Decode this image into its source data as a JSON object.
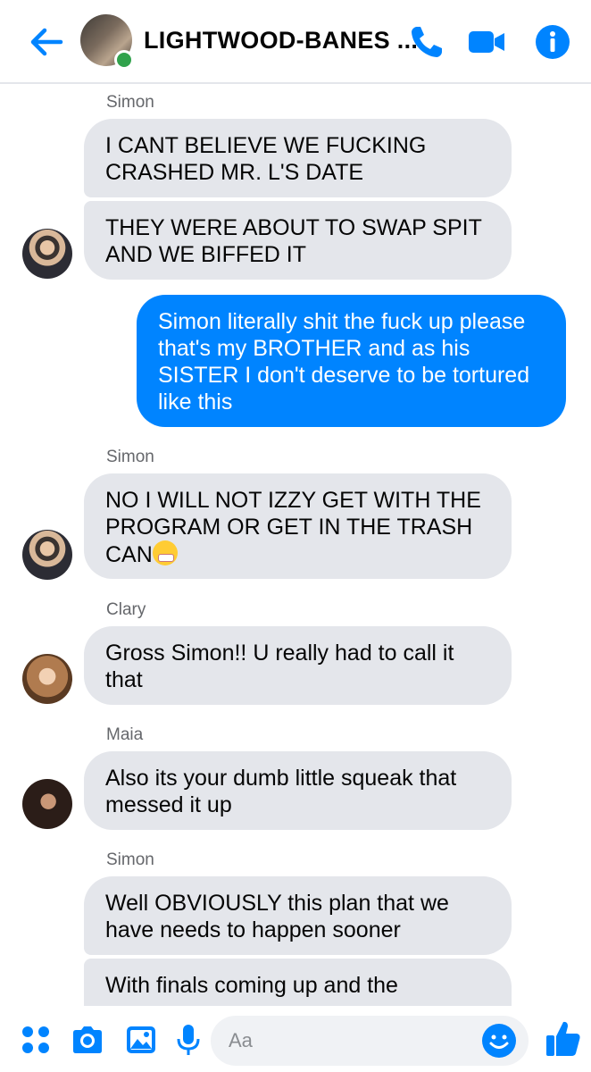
{
  "header": {
    "title": "LIGHTWOOD-BANES ...",
    "back_icon": "back-arrow-icon",
    "call_icon": "phone-icon",
    "video_icon": "video-camera-icon",
    "info_icon": "info-icon",
    "online": true
  },
  "messages": [
    {
      "type": "sender",
      "text": "Simon"
    },
    {
      "type": "received",
      "text": "I CANT BELIEVE WE FUCKING CRASHED MR. L'S DATE"
    },
    {
      "type": "received",
      "text": "THEY WERE ABOUT TO SWAP SPIT AND WE BIFFED IT"
    },
    {
      "type": "sent",
      "text": "Simon literally shit the fuck up please that's my BROTHER and as his SISTER I don't deserve to be tortured like this"
    },
    {
      "type": "sender",
      "text": "Simon"
    },
    {
      "type": "received",
      "text": "NO I WILL NOT IZZY GET WITH THE PROGRAM OR GET IN THE TRASH CAN"
    },
    {
      "type": "sender",
      "text": "Clary"
    },
    {
      "type": "received",
      "text": "Gross Simon!! U really had to call it that"
    },
    {
      "type": "sender",
      "text": "Maia"
    },
    {
      "type": "received",
      "text": "Also its your dumb little squeak that messed it up"
    },
    {
      "type": "sender",
      "text": "Simon"
    },
    {
      "type": "received",
      "text": "Well OBVIOUSLY this plan that we have needs to happen sooner"
    },
    {
      "type": "received",
      "text": "With finals coming up and the"
    }
  ],
  "composer": {
    "placeholder": "Aa",
    "icons": [
      "apps-icon",
      "camera-icon",
      "gallery-icon",
      "microphone-icon",
      "emoji-icon",
      "thumbs-up-icon"
    ]
  },
  "colors": {
    "accent": "#0084ff",
    "received_bubble": "#e4e6eb",
    "sender_name": "#65676b",
    "online": "#31a24c"
  }
}
